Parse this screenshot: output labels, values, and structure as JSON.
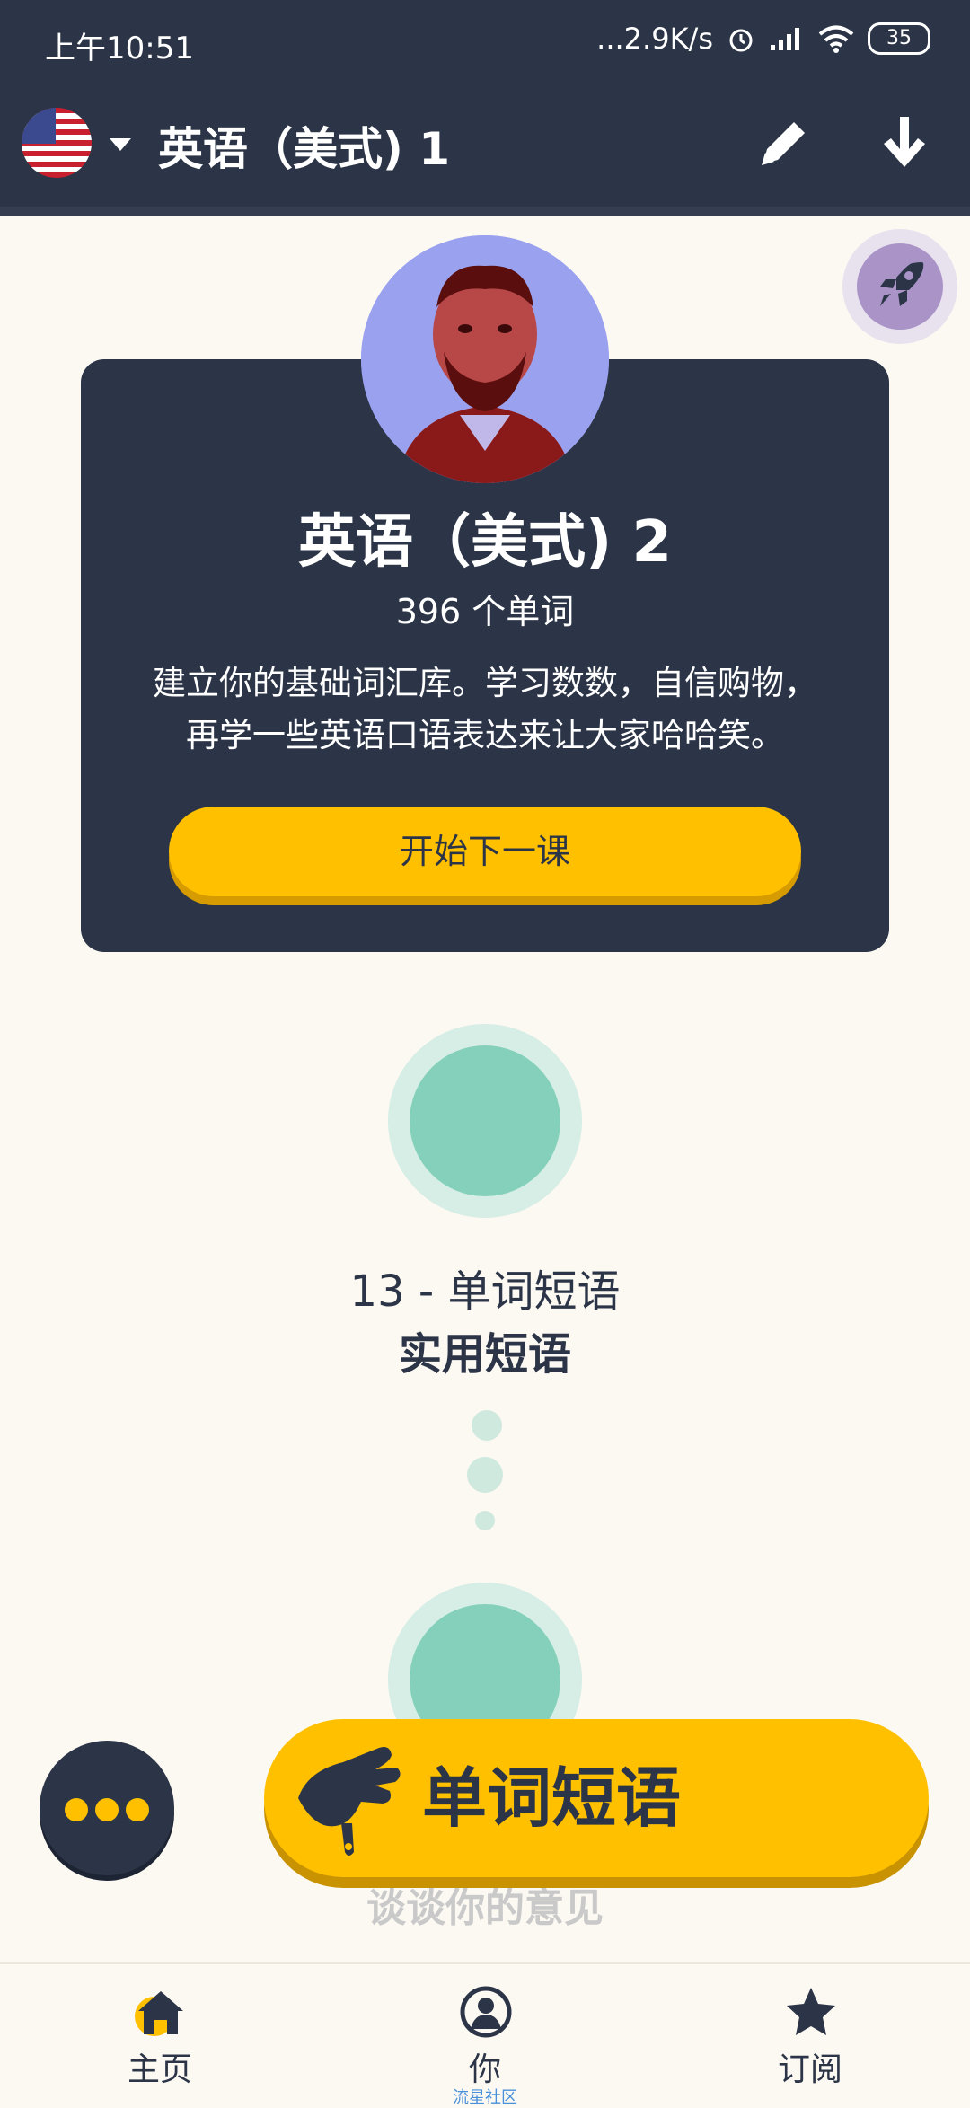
{
  "status_bar": {
    "time": "上午10:51",
    "network_speed": "...2.9K/s",
    "battery": "35"
  },
  "header": {
    "title": "英语（美式) 1",
    "flag_icon": "us-flag-icon"
  },
  "course_card": {
    "title": "英语（美式) 2",
    "word_count": "396 个单词",
    "description_line1": "建立你的基础词汇库。学习数数，自信购物，",
    "description_line2": "再学一些英语口语表达来让大家哈哈笑。",
    "start_button": "开始下一课"
  },
  "lesson": {
    "number_label": "13 - 单词短语",
    "name": "实用短语"
  },
  "bottom_actions": {
    "faded_text": "谈谈你的意见",
    "cta_label": "单词短语"
  },
  "nav": {
    "home": "主页",
    "you": "你",
    "you_sub": "流星社区",
    "subscribe": "订阅"
  },
  "colors": {
    "dark": "#2c3547",
    "accent": "#ffc000",
    "mint": "#84d0bb",
    "background": "#fcf9f3"
  }
}
